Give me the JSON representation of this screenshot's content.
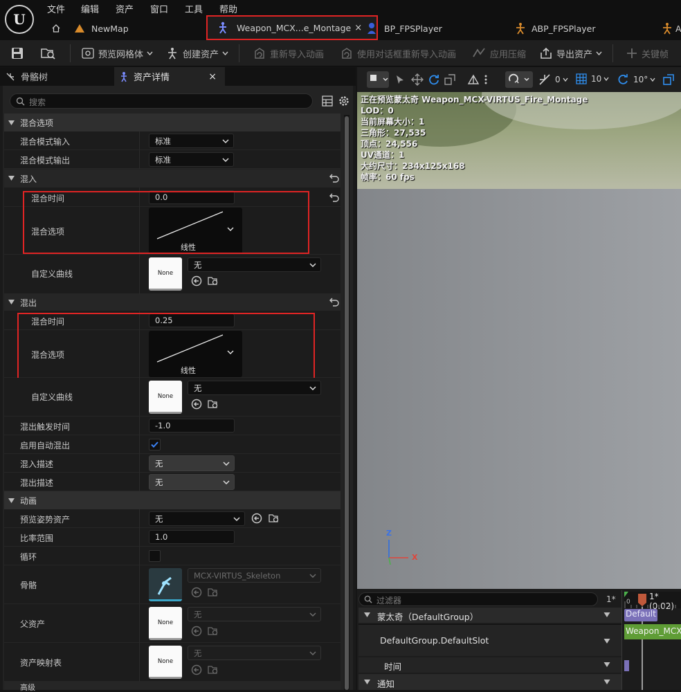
{
  "menu": [
    "文件",
    "编辑",
    "资产",
    "窗口",
    "工具",
    "帮助"
  ],
  "tabs": {
    "map": "NewMap",
    "montage": "Weapon_MCX...e_Montage",
    "player": "BP_FPSPlayer",
    "abp": "ABP_FPSPlayer",
    "extra": "A"
  },
  "toolbar": {
    "preview_mesh": "预览网格体",
    "create_asset": "创建资产",
    "reimport": "重新导入动画",
    "reimport_dialog": "使用对话框重新导入动画",
    "apply_compression": "应用压缩",
    "export_asset": "导出资产",
    "keyframe": "关键帧"
  },
  "panel": {
    "tab_skeleton": "骨骼树",
    "tab_details": "资产详情",
    "search_placeholder": "搜索"
  },
  "blend_options": {
    "title": "混合选项",
    "mode_in_label": "混合模式输入",
    "mode_in": "标准",
    "mode_out_label": "混合模式输出",
    "mode_out": "标准"
  },
  "blend_in": {
    "title": "混入",
    "time_label": "混合时间",
    "time": "0.0",
    "option_label": "混合选项",
    "curve_type": "线性",
    "custom_curve_label": "自定义曲线",
    "custom_curve": "无",
    "thumb": "None"
  },
  "blend_out": {
    "title": "混出",
    "time_label": "混合时间",
    "time": "0.25",
    "option_label": "混合选项",
    "curve_type": "线性",
    "custom_curve_label": "自定义曲线",
    "custom_curve": "无",
    "thumb": "None"
  },
  "misc": {
    "trigger_label": "混出触发时间",
    "trigger": "-1.0",
    "auto_label": "启用自动混出",
    "blend_in_desc_label": "混入描述",
    "blend_in_desc": "无",
    "blend_out_desc_label": "混出描述",
    "blend_out_desc": "无"
  },
  "animation": {
    "title": "动画",
    "preview_pose_label": "预览姿势资产",
    "preview_pose": "无",
    "rate_label": "比率范围",
    "rate": "1.0",
    "loop_label": "循环",
    "skeleton_label": "骨骼",
    "skeleton": "MCX-VIRTUS_Skeleton",
    "parent_label": "父资产",
    "parent": "无",
    "parent_thumb": "None",
    "map_label": "资产映射表",
    "map": "无",
    "map_thumb": "None",
    "advanced": "高级"
  },
  "viewport": {
    "toolbar": {
      "v1": "0",
      "v2": "10",
      "v3": "10°"
    },
    "lines": [
      "正在预览蒙太奇 Weapon_MCX-VIRTUS_Fire_Montage",
      "LOD：0",
      "当前屏幕大小：1",
      "三角形：27,535",
      "顶点：24,556",
      "UV通道：1",
      "大约尺寸：234x125x168",
      "帧率：60 fps"
    ],
    "axis_z": "Z",
    "axis_x": "X"
  },
  "timeline": {
    "filter_placeholder": "过滤器",
    "star": "1*",
    "frame": "1* (0.02)",
    "tick0": "0",
    "group": "蒙太奇（DefaultGroup）",
    "group_badge": "Default",
    "slot": "DefaultGroup.DefaultSlot",
    "slot_clip": "Weapon_MCX",
    "time": "时间",
    "notify": "通知"
  },
  "colors": {
    "highlight": "#e02424",
    "checkbox": "#2f6fd6",
    "accent_orange": "#d98b2b",
    "clip_green": "#5f9d36",
    "badge_purple": "#7a70b8"
  }
}
